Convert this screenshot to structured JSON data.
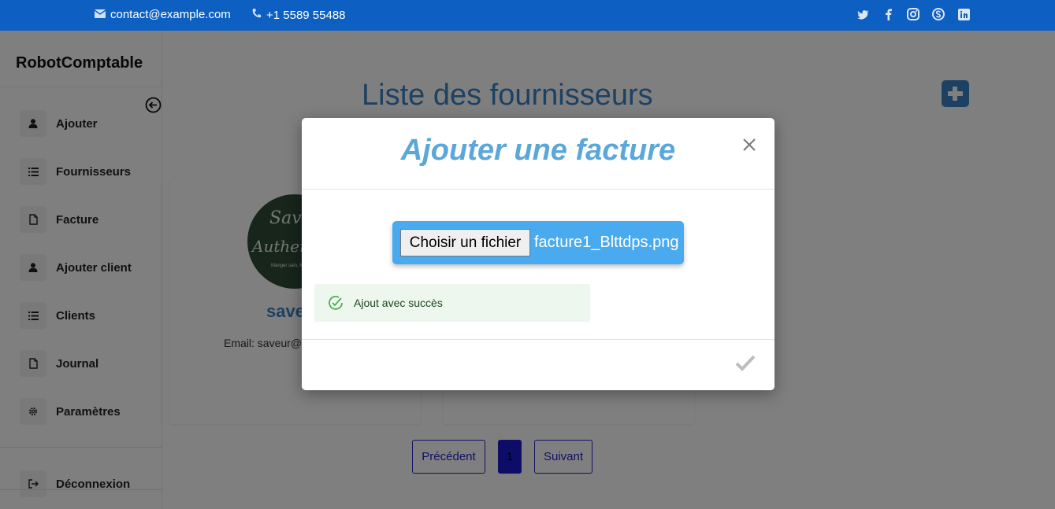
{
  "topbar": {
    "email": "contact@example.com",
    "phone": "+1 5589 55488",
    "social": [
      "twitter-icon",
      "facebook-icon",
      "instagram-icon",
      "skype-icon",
      "linkedin-icon"
    ],
    "background": "#0d5fc2"
  },
  "sidebar": {
    "brand": "RobotComptable",
    "items": [
      {
        "label": "Ajouter",
        "icon": "user-icon"
      },
      {
        "label": "Fournisseurs",
        "icon": "list-icon"
      },
      {
        "label": "Facture",
        "icon": "file-icon"
      },
      {
        "label": "Ajouter client",
        "icon": "user-icon"
      },
      {
        "label": "Clients",
        "icon": "list-icon"
      },
      {
        "label": "Journal",
        "icon": "file-icon"
      },
      {
        "label": "Paramètres",
        "icon": "gear-icon"
      }
    ],
    "logout": "Déconnexion"
  },
  "main": {
    "title": "Liste des fournisseurs",
    "cards": [
      {
        "name": "saveur",
        "email": "Email: saveur@",
        "logo_line1": "Saveur",
        "logo_line2": "Authentique",
        "logo_line3": "Manger sain, Mieux vivre"
      }
    ],
    "pagination": {
      "prev": "Précédent",
      "current": "1",
      "next": "Suivant"
    }
  },
  "modal": {
    "title": "Ajouter une facture",
    "file_button": "Choisir un fichier",
    "file_name": "facture1_Blttdps.png",
    "success_message": "Ajout avec succès",
    "accent": "#5aa7d9"
  }
}
